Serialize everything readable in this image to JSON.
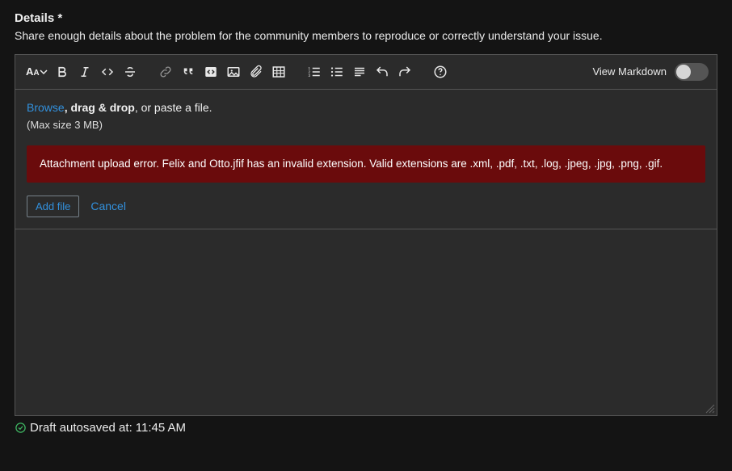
{
  "header": {
    "title": "Details *",
    "subtitle": "Share enough details about the problem for the community members to reproduce or correctly understand your issue."
  },
  "toolbar": {
    "font_size_label": "A",
    "view_markdown_label": "View Markdown"
  },
  "upload": {
    "browse_label": "Browse",
    "drag_drop_text": ", drag & drop",
    "paste_text": ", or paste a file.",
    "max_size": "(Max size 3 MB)"
  },
  "error": {
    "message": "Attachment upload error. Felix and Otto.jfif has an invalid extension. Valid extensions are .xml, .pdf, .txt, .log, .jpeg, .jpg, .png, .gif."
  },
  "buttons": {
    "add_file": "Add file",
    "cancel": "Cancel"
  },
  "status": {
    "autosave_prefix": "Draft autosaved at: ",
    "autosave_time": "11:45 AM"
  }
}
